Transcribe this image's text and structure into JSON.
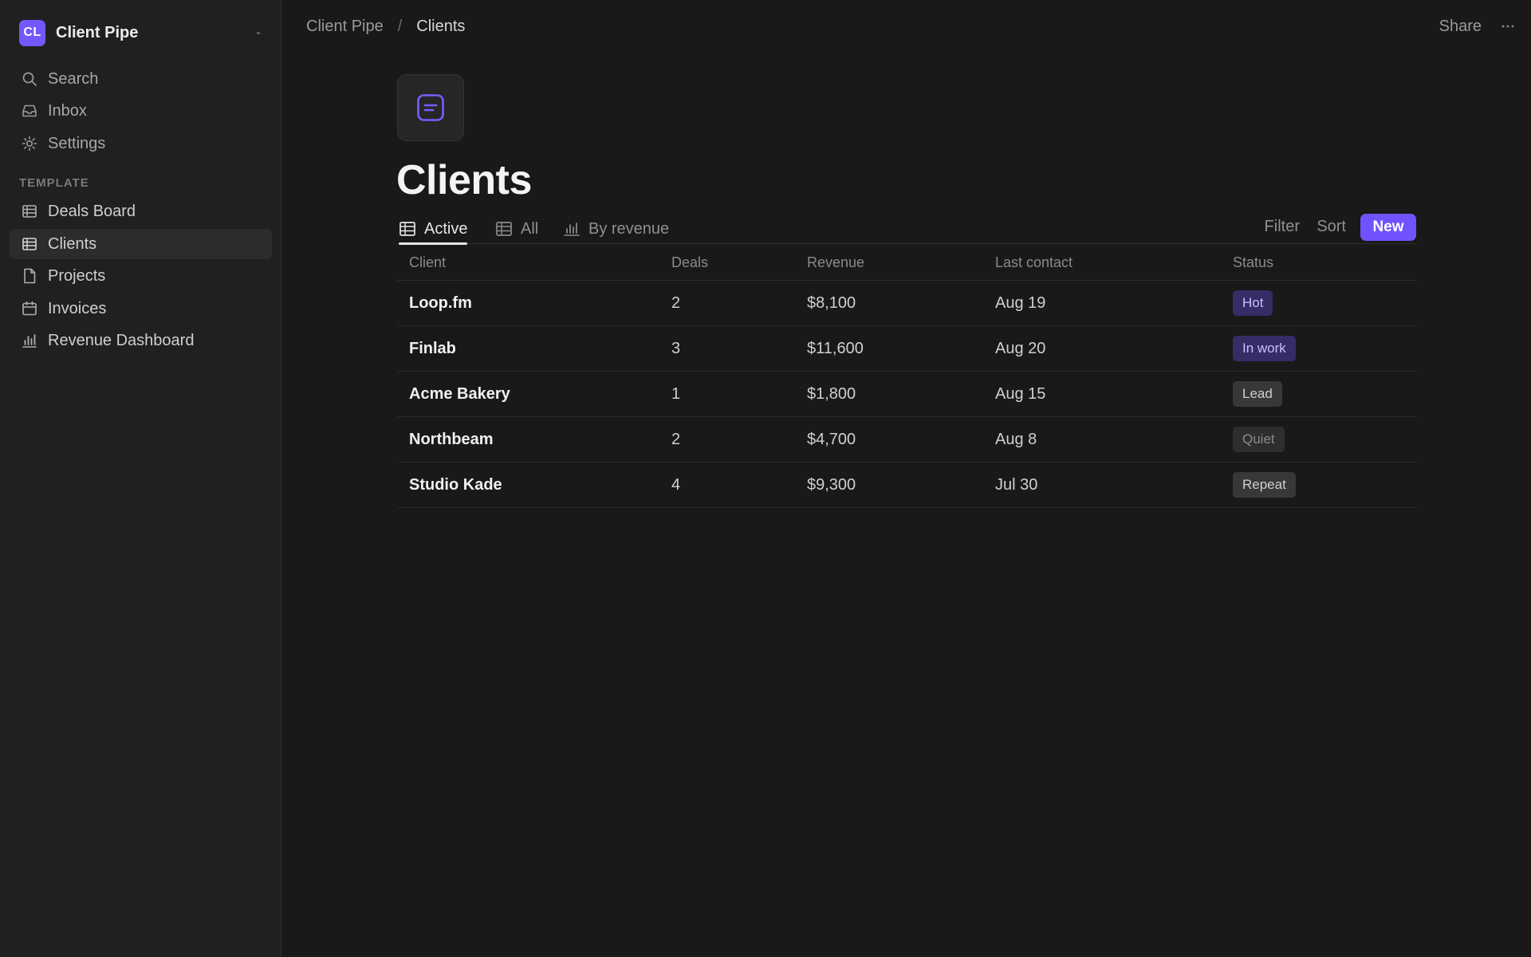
{
  "workspace": {
    "initials": "CL",
    "name": "Client Pipe",
    "avatar_color": "#7357ff"
  },
  "sidebar": {
    "top_items": [
      {
        "label": "Search",
        "icon": "search-icon"
      },
      {
        "label": "Inbox",
        "icon": "inbox-icon"
      },
      {
        "label": "Settings",
        "icon": "gear-icon"
      }
    ],
    "section_label": "TEMPLATE",
    "pages": [
      {
        "label": "Deals Board",
        "icon": "table-icon",
        "selected": false
      },
      {
        "label": "Clients",
        "icon": "table-icon",
        "selected": true
      },
      {
        "label": "Projects",
        "icon": "document-icon",
        "selected": false
      },
      {
        "label": "Invoices",
        "icon": "calendar-icon",
        "selected": false
      },
      {
        "label": "Revenue Dashboard",
        "icon": "bar-chart-icon",
        "selected": false
      }
    ]
  },
  "topbar": {
    "breadcrumb": {
      "parent": "Client Pipe",
      "separator": "/",
      "current": "Clients"
    },
    "share_label": "Share",
    "more_label": "···"
  },
  "page": {
    "icon": "note-icon",
    "title": "Clients"
  },
  "views": {
    "tabs": [
      {
        "label": "Active",
        "icon": "table-icon",
        "active": true
      },
      {
        "label": "All",
        "icon": "table-icon",
        "active": false
      },
      {
        "label": "By revenue",
        "icon": "bar-chart-icon",
        "active": false
      }
    ],
    "filter_label": "Filter",
    "sort_label": "Sort",
    "new_label": "New",
    "accent_color": "#7152ff"
  },
  "table": {
    "columns": [
      "Client",
      "Deals",
      "Revenue",
      "Last contact",
      "Status"
    ],
    "rows": [
      {
        "client": "Loop.fm",
        "deals": "2",
        "revenue": "$8,100",
        "last_contact": "Aug 19",
        "status": "Hot",
        "status_style": "purple"
      },
      {
        "client": "Finlab",
        "deals": "3",
        "revenue": "$11,600",
        "last_contact": "Aug 20",
        "status": "In work",
        "status_style": "purple"
      },
      {
        "client": "Acme Bakery",
        "deals": "1",
        "revenue": "$1,800",
        "last_contact": "Aug 15",
        "status": "Lead",
        "status_style": "gray"
      },
      {
        "client": "Northbeam",
        "deals": "2",
        "revenue": "$4,700",
        "last_contact": "Aug 8",
        "status": "Quiet",
        "status_style": "dark"
      },
      {
        "client": "Studio Kade",
        "deals": "4",
        "revenue": "$9,300",
        "last_contact": "Jul 30",
        "status": "Repeat",
        "status_style": "gray"
      }
    ]
  }
}
